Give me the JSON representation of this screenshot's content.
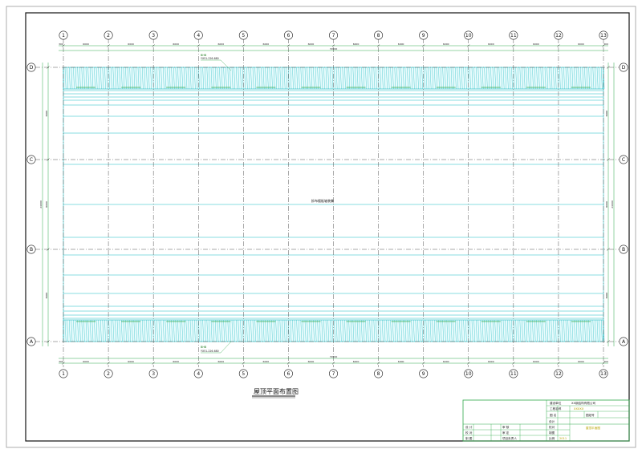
{
  "drawing": {
    "title": "屋顶平面布置图",
    "center_note": "拆布楼板轴装集"
  },
  "grid": {
    "columns": [
      "1",
      "2",
      "3",
      "4",
      "5",
      "6",
      "7",
      "8",
      "9",
      "10",
      "11",
      "12",
      "13"
    ],
    "rows": [
      "D",
      "C",
      "B",
      "A"
    ],
    "bay_dim": "6000",
    "total_dim": "72000",
    "end_dim": "300",
    "row_dims": [
      "8000",
      "8000",
      "8000"
    ],
    "total_row_dim": "24000"
  },
  "annotations": {
    "top_label": "BHB",
    "top_sub": "YX51-226-680",
    "bottom_label": "BHB",
    "bottom_sub": "YX51-226-680"
  },
  "title_block": {
    "project_company": "建设单位",
    "project_company_value": "XX钢结构有限公司",
    "project_name": "工程名称",
    "project_name_value": "XXXXX",
    "drawing_label": "图 名",
    "drawing_no_label": "图纸号",
    "design": "设计",
    "check": "校对",
    "review": "审核",
    "approve": "审定",
    "drawn": "制图",
    "date": "日期",
    "scale": "比例",
    "sign_design": "设 计",
    "sign_check": "校 对",
    "sign_draw": "制 图",
    "sign_review": "审 核",
    "sign_approve": "审 定",
    "sign_manager": "项目负责人",
    "drawing_value": "屋顶平面图",
    "date_value": "2011"
  },
  "colors": {
    "cyan": "#17b9c2",
    "green": "#2ea84a",
    "axis": "#555555",
    "border": "#111111"
  }
}
